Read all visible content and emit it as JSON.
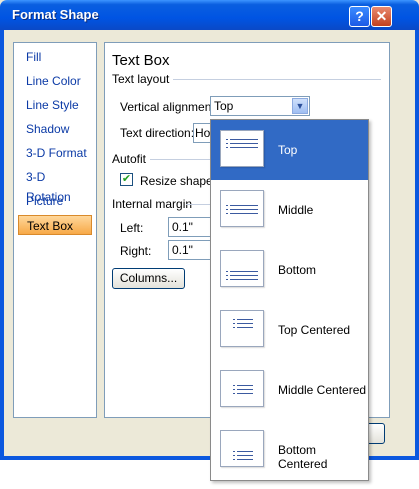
{
  "window": {
    "title": "Format Shape",
    "help_label": "?",
    "close_label": "✕"
  },
  "nav": {
    "items": [
      {
        "label": "Fill",
        "selected": false
      },
      {
        "label": "Line Color",
        "selected": false
      },
      {
        "label": "Line Style",
        "selected": false
      },
      {
        "label": "Shadow",
        "selected": false
      },
      {
        "label": "3-D Format",
        "selected": false
      },
      {
        "label": "3-D Rotation",
        "selected": false
      },
      {
        "label": "Picture",
        "selected": false
      },
      {
        "label": "Text Box",
        "selected": true
      }
    ]
  },
  "panel": {
    "title": "Text Box",
    "text_layout": {
      "heading": "Text layout",
      "vertical_alignment_label": "Vertical alignment:",
      "vertical_alignment_value": "Top",
      "text_direction_label": "Text direction:",
      "text_direction_value": "Hor"
    },
    "autofit": {
      "heading": "Autofit",
      "resize_label": "Resize shape t",
      "checked": true
    },
    "internal_margin": {
      "heading": "Internal margin",
      "left_label": "Left:",
      "left_value": "0.1\"",
      "right_label": "Right:",
      "right_value": "0.1\""
    },
    "columns_button": "Columns..."
  },
  "dropdown": {
    "options": [
      {
        "label": "Top",
        "icon": "align-top-icon",
        "active": true
      },
      {
        "label": "Middle",
        "icon": "align-middle-icon",
        "active": false
      },
      {
        "label": "Bottom",
        "icon": "align-bottom-icon",
        "active": false
      },
      {
        "label": "Top Centered",
        "icon": "align-top-centered-icon",
        "active": false
      },
      {
        "label": "Middle Centered",
        "icon": "align-middle-centered-icon",
        "active": false
      },
      {
        "label": "Bottom Centered",
        "icon": "align-bottom-centered-icon",
        "active": false
      }
    ]
  },
  "colors": {
    "title_bar": "#0054e3",
    "selection": "#316ac5",
    "nav_selected": "#f7a948",
    "link_text": "#0b3aa6"
  }
}
